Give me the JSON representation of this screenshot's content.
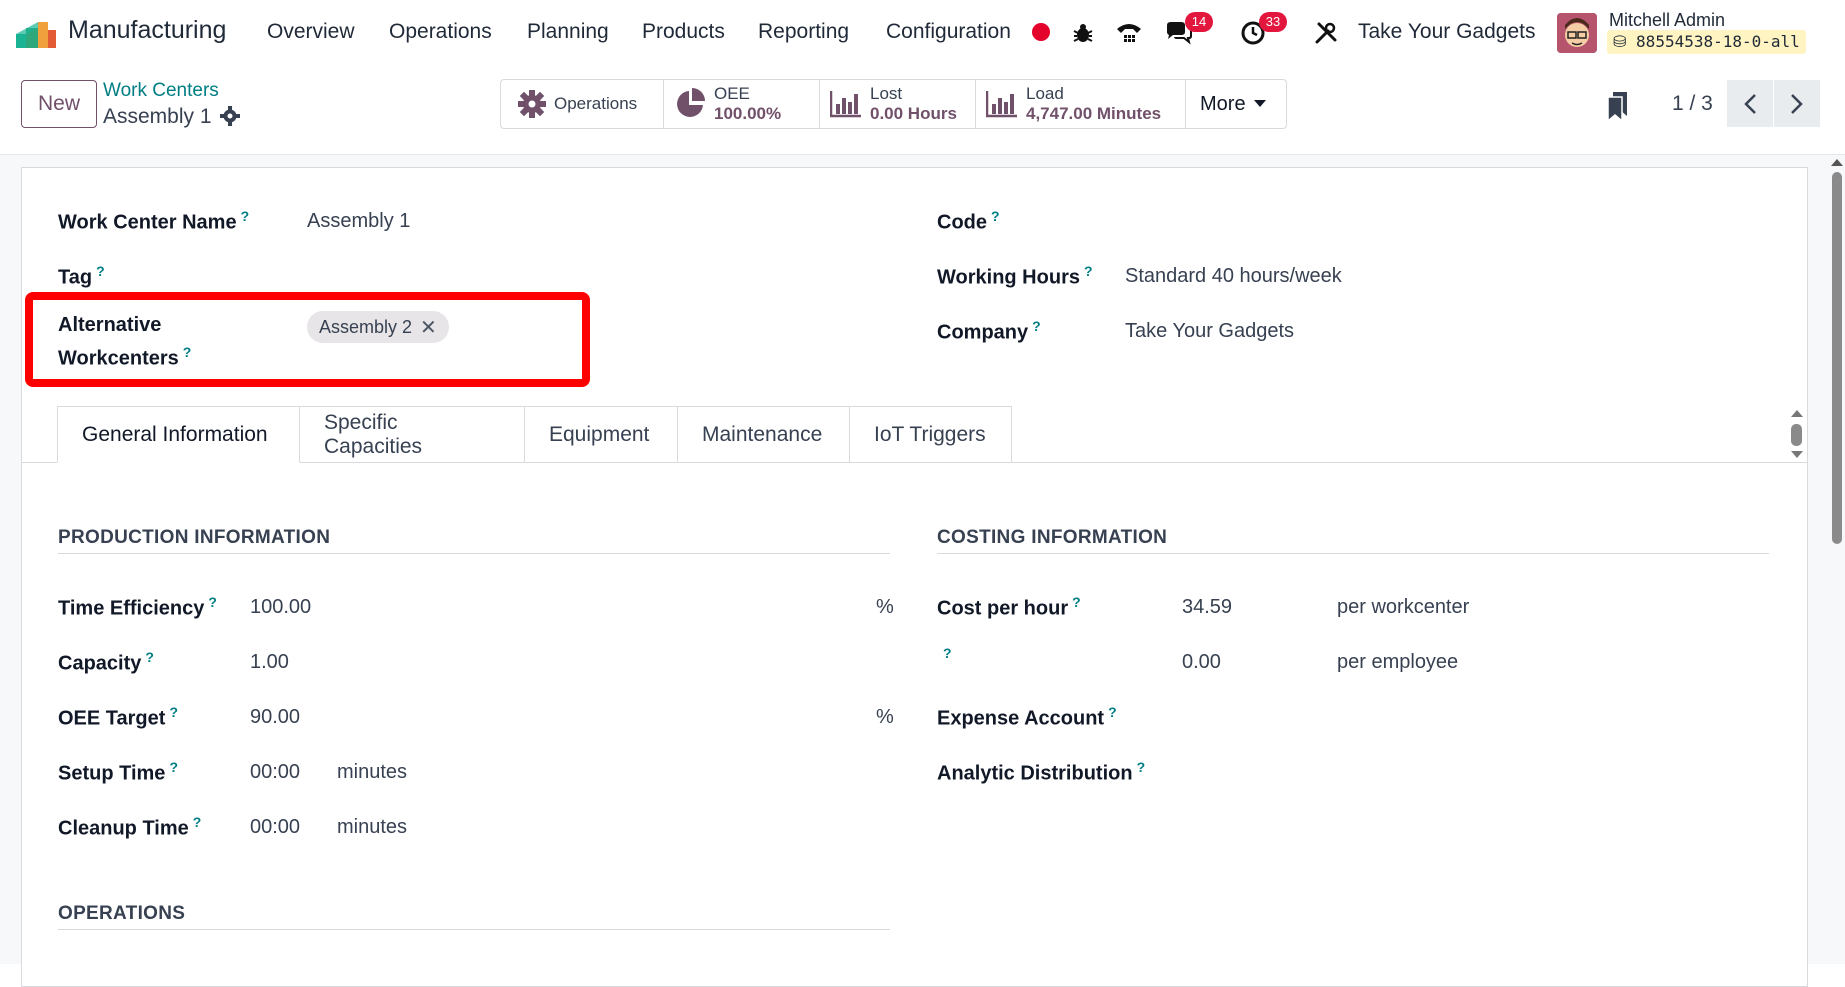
{
  "navbar": {
    "app_name": "Manufacturing",
    "menu": [
      "Overview",
      "Operations",
      "Planning",
      "Products",
      "Reporting",
      "Configuration"
    ],
    "messages_count": "14",
    "activities_count": "33",
    "company": "Take Your Gadgets",
    "user_name": "Mitchell Admin",
    "database": "88554538-18-0-all"
  },
  "control_panel": {
    "new_label": "New",
    "breadcrumb_parent": "Work Centers",
    "breadcrumb_current": "Assembly 1",
    "smart_buttons": {
      "operations": "Operations",
      "oee_label": "OEE",
      "oee_value": "100.00%",
      "lost_label": "Lost",
      "lost_value": "0.00 Hours",
      "load_label": "Load",
      "load_value": "4,747.00 Minutes",
      "more": "More"
    },
    "pager": "1 / 3"
  },
  "form": {
    "work_center_name_label": "Work Center Name",
    "work_center_name": "Assembly 1",
    "tag_label": "Tag",
    "alt_label_1": "Alternative",
    "alt_label_2": "Workcenters",
    "alt_tag": "Assembly 2",
    "code_label": "Code",
    "working_hours_label": "Working Hours",
    "working_hours": "Standard 40 hours/week",
    "company_label": "Company",
    "company": "Take Your Gadgets",
    "help_mark": "?"
  },
  "tabs": [
    "General Information",
    "Specific Capacities",
    "Equipment",
    "Maintenance",
    "IoT Triggers"
  ],
  "production": {
    "title": "PRODUCTION INFORMATION",
    "time_efficiency_label": "Time Efficiency",
    "time_efficiency": "100.00",
    "percent": "%",
    "capacity_label": "Capacity",
    "capacity": "1.00",
    "oee_target_label": "OEE Target",
    "oee_target": "90.00",
    "setup_time_label": "Setup Time",
    "setup_time": "00:00",
    "cleanup_time_label": "Cleanup Time",
    "cleanup_time": "00:00",
    "minutes": "minutes"
  },
  "costing": {
    "title": "COSTING INFORMATION",
    "cost_per_hour_label": "Cost per hour",
    "cost_per_hour": "34.59",
    "per_workcenter": "per workcenter",
    "employee_cost": "0.00",
    "per_employee": "per employee",
    "expense_account_label": "Expense Account",
    "analytic_distribution_label": "Analytic Distribution"
  },
  "operations_section": {
    "title": "OPERATIONS"
  },
  "colors": {
    "brand": "#71506a",
    "link": "#017e84",
    "badge": "#e3173e",
    "highlight": "#ff0000"
  }
}
